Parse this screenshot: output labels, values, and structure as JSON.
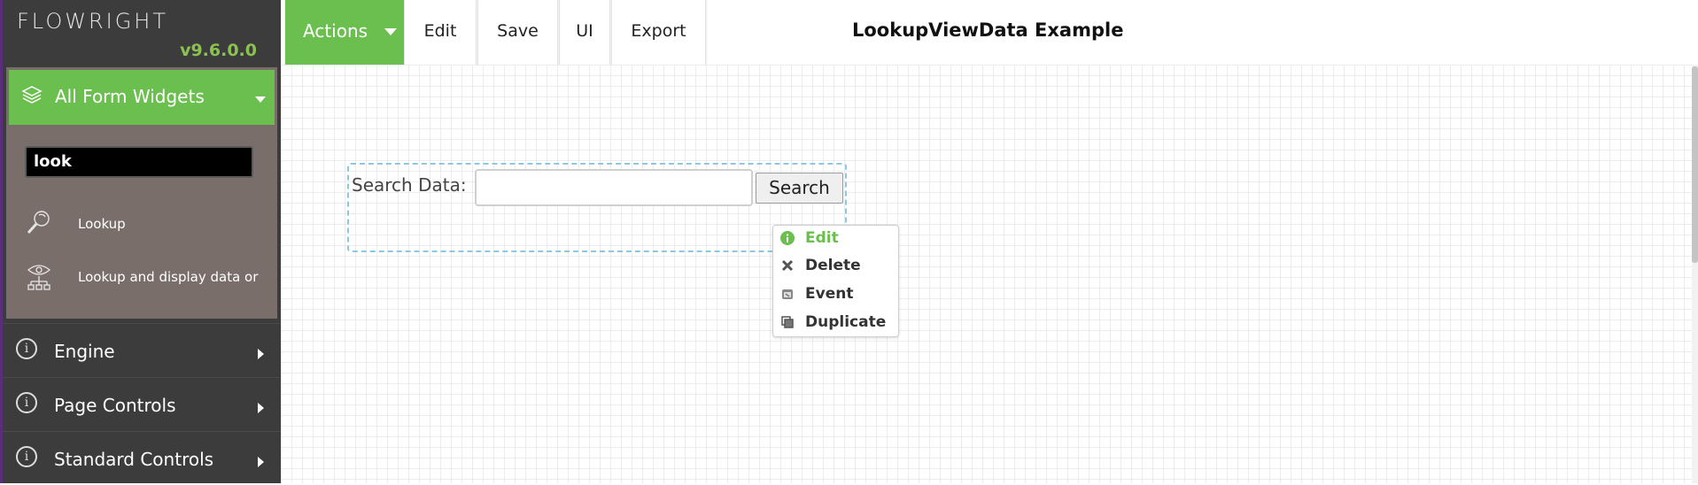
{
  "app": {
    "logo_text": "FLOWRIGHT",
    "version": "v9.6.0.0",
    "accent_color": "#6bbf4e"
  },
  "sidebar": {
    "widgets_header": "All Form Widgets",
    "search_value": "look",
    "widget_items": [
      {
        "label": "Lookup",
        "icon": "magnifier-icon"
      },
      {
        "label": "Lookup and display data or",
        "icon": "eye-hierarchy-icon"
      }
    ],
    "nav_items": [
      {
        "label": "Engine",
        "icon": "info-icon"
      },
      {
        "label": "Page Controls",
        "icon": "info-icon"
      },
      {
        "label": "Standard Controls",
        "icon": "info-icon"
      }
    ]
  },
  "toolbar": {
    "actions_label": "Actions",
    "buttons": [
      "Edit",
      "Save",
      "UI",
      "Export"
    ],
    "page_title": "LookupViewData Example"
  },
  "canvas": {
    "search_label": "Search Data:",
    "search_value": "",
    "search_button": "Search"
  },
  "context_menu": {
    "items": [
      {
        "label": "Edit",
        "icon": "info-icon",
        "color": "#6bbf4e"
      },
      {
        "label": "Delete",
        "icon": "close-icon"
      },
      {
        "label": "Event",
        "icon": "event-icon"
      },
      {
        "label": "Duplicate",
        "icon": "duplicate-icon"
      }
    ]
  }
}
